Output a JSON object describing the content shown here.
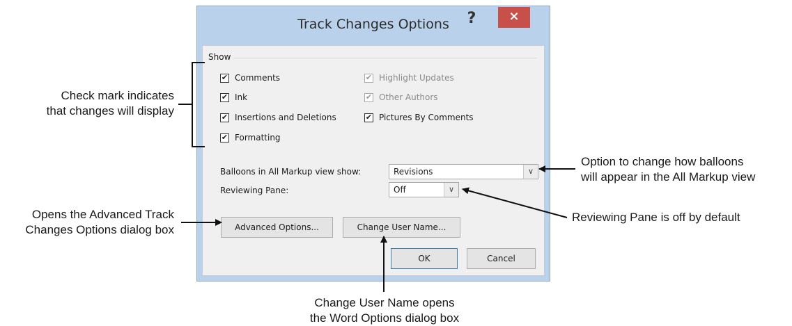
{
  "dialog": {
    "title": "Track Changes Options",
    "help_label": "?",
    "close_label": "×",
    "show_group_label": "Show",
    "checkboxes": [
      {
        "label": "Comments",
        "checked": true,
        "disabled": false
      },
      {
        "label": "Ink",
        "checked": true,
        "disabled": false
      },
      {
        "label": "Insertions and Deletions",
        "checked": true,
        "disabled": false
      },
      {
        "label": "Formatting",
        "checked": true,
        "disabled": false
      },
      {
        "label": "Highlight Updates",
        "checked": true,
        "disabled": true
      },
      {
        "label": "Other Authors",
        "checked": true,
        "disabled": true
      },
      {
        "label": "Pictures By Comments",
        "checked": true,
        "disabled": false
      }
    ],
    "balloons_label": "Balloons in All Markup view show:",
    "balloons_value": "Revisions",
    "reviewing_pane_label": "Reviewing Pane:",
    "reviewing_pane_value": "Off",
    "advanced_options_label": "Advanced Options...",
    "change_user_name_label": "Change User Name...",
    "ok_label": "OK",
    "cancel_label": "Cancel"
  },
  "annotations": {
    "checkmark": [
      "Check mark indicates",
      "that changes will display"
    ],
    "balloons": [
      "Option to change how balloons",
      "will appear in the All Markup view"
    ],
    "reviewing_pane": [
      "Reviewing Pane is off by default"
    ],
    "advanced": [
      "Opens the Advanced Track",
      "Changes Options dialog box"
    ],
    "change_user": [
      "Change User Name opens",
      "the Word Options dialog box"
    ]
  },
  "icons": {
    "checkmark_glyph": "✔",
    "dropdown_glyph": "∨"
  },
  "colors": {
    "dialog_frame": "#b9d1ea",
    "client_bg": "#f0f0f0",
    "close_button": "#c7504a"
  }
}
